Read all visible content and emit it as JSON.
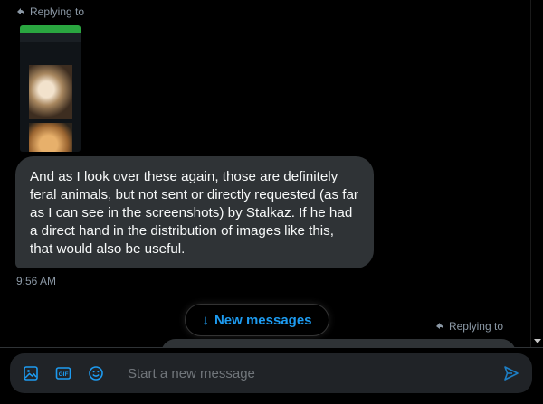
{
  "thread": {
    "replying_top": "Replying to",
    "message_text": "And as I look over these again, those are definitely feral animals, but not sent or directly requested (as far as I can see in the screenshots) by Stalkaz. If he had a direct hand in the distribution of images like this, that would also be useful.",
    "timestamp": "9:56 AM",
    "new_messages_label": "New messages",
    "new_messages_arrow": "↓",
    "replying_right": "Replying to"
  },
  "composer": {
    "placeholder": "Start a new message",
    "icons": [
      "image-icon",
      "gif-icon",
      "emoji-icon",
      "send-icon"
    ]
  },
  "colors": {
    "background": "#000000",
    "bubble": "#2f3336",
    "accent": "#1d9bf0",
    "muted_text": "#8b98a5",
    "composer_bg": "#202327"
  }
}
